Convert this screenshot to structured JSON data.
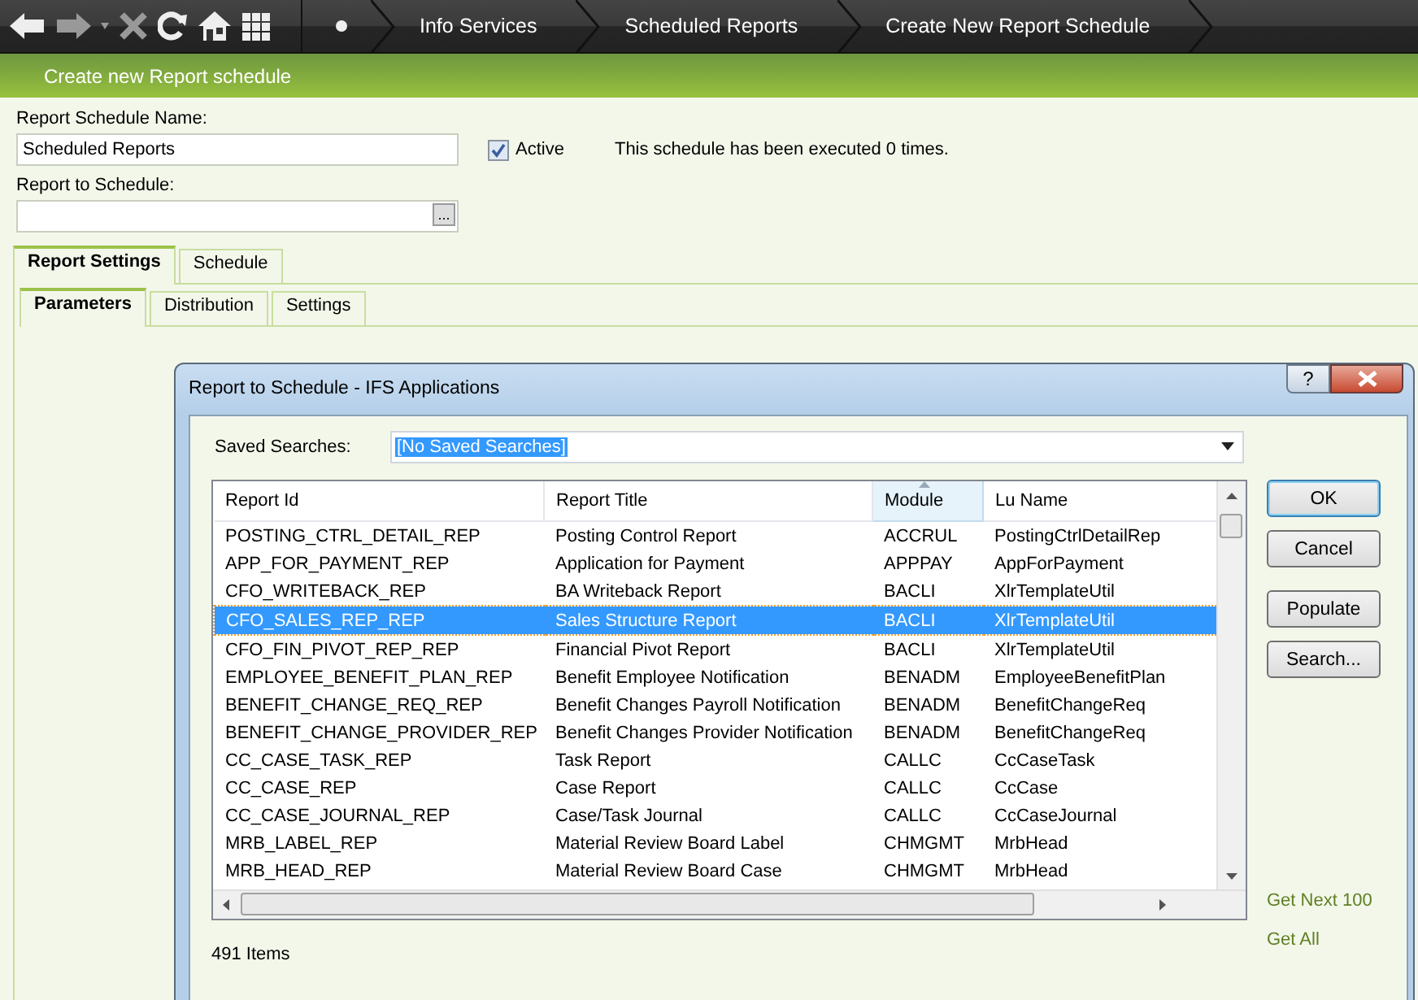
{
  "toolbar": {
    "breadcrumbs": [
      "Info Services",
      "Scheduled Reports",
      "Create New Report Schedule"
    ]
  },
  "header": {
    "title": "Create new Report schedule"
  },
  "form": {
    "name_label": "Report Schedule Name:",
    "name_value": "Scheduled Reports",
    "active": {
      "label": "Active",
      "checked": true
    },
    "execution_note": "This schedule has been executed 0 times.",
    "report_label": "Report to Schedule:",
    "report_button": "..."
  },
  "tabs": [
    {
      "label": "Report Settings",
      "selected": true
    },
    {
      "label": "Schedule",
      "selected": false
    }
  ],
  "subtabs": [
    {
      "label": "Parameters",
      "selected": true
    },
    {
      "label": "Distribution",
      "selected": false
    },
    {
      "label": "Settings",
      "selected": false
    }
  ],
  "dialog": {
    "title": "Report to Schedule - IFS Applications",
    "help": "?",
    "saved_searches_label": "Saved Searches:",
    "saved_search_value": "[No Saved Searches]",
    "table": {
      "columns": [
        {
          "label": "Report Id",
          "sorted": false
        },
        {
          "label": "Report Title",
          "sorted": false
        },
        {
          "label": "Module",
          "sorted": true
        },
        {
          "label": "Lu Name",
          "sorted": false
        }
      ],
      "rows": [
        {
          "cells": [
            "POSTING_CTRL_DETAIL_REP",
            "Posting Control Report",
            "ACCRUL",
            "PostingCtrlDetailRep"
          ],
          "selected": false
        },
        {
          "cells": [
            "APP_FOR_PAYMENT_REP",
            "Application for Payment",
            "APPPAY",
            "AppForPayment"
          ],
          "selected": false
        },
        {
          "cells": [
            "CFO_WRITEBACK_REP",
            "BA Writeback Report",
            "BACLI",
            "XlrTemplateUtil"
          ],
          "selected": false
        },
        {
          "cells": [
            "CFO_SALES_REP_REP",
            "Sales Structure Report",
            "BACLI",
            "XlrTemplateUtil"
          ],
          "selected": true
        },
        {
          "cells": [
            "CFO_FIN_PIVOT_REP_REP",
            "Financial Pivot Report",
            "BACLI",
            "XlrTemplateUtil"
          ],
          "selected": false
        },
        {
          "cells": [
            "EMPLOYEE_BENEFIT_PLAN_REP",
            "Benefit Employee Notification",
            "BENADM",
            "EmployeeBenefitPlan"
          ],
          "selected": false
        },
        {
          "cells": [
            "BENEFIT_CHANGE_REQ_REP",
            "Benefit Changes Payroll Notification",
            "BENADM",
            "BenefitChangeReq"
          ],
          "selected": false
        },
        {
          "cells": [
            "BENEFIT_CHANGE_PROVIDER_REP",
            "Benefit Changes Provider Notification",
            "BENADM",
            "BenefitChangeReq"
          ],
          "selected": false
        },
        {
          "cells": [
            "CC_CASE_TASK_REP",
            "Task Report",
            "CALLC",
            "CcCaseTask"
          ],
          "selected": false
        },
        {
          "cells": [
            "CC_CASE_REP",
            "Case Report",
            "CALLC",
            "CcCase"
          ],
          "selected": false
        },
        {
          "cells": [
            "CC_CASE_JOURNAL_REP",
            "Case/Task Journal",
            "CALLC",
            "CcCaseJournal"
          ],
          "selected": false
        },
        {
          "cells": [
            "MRB_LABEL_REP",
            "Material Review Board Label",
            "CHMGMT",
            "MrbHead"
          ],
          "selected": false
        },
        {
          "cells": [
            "MRB_HEAD_REP",
            "Material Review Board Case",
            "CHMGMT",
            "MrbHead"
          ],
          "selected": false
        }
      ]
    },
    "buttons": [
      {
        "label": "OK",
        "default": true
      },
      {
        "label": "Cancel",
        "default": false
      },
      {
        "label": "Populate",
        "default": false
      },
      {
        "label": "Search...",
        "default": false
      }
    ],
    "item_count": "491 Items",
    "links": [
      "Get Next 100",
      "Get All"
    ]
  }
}
